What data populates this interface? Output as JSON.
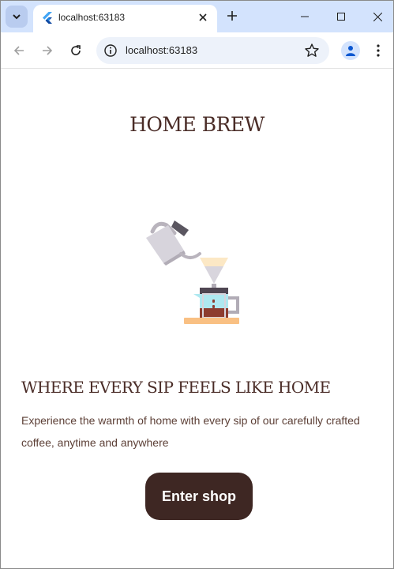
{
  "browser": {
    "tab_title": "localhost:63183",
    "url": "localhost:63183",
    "icons": {
      "tab_search": "chevron-down-icon",
      "favicon": "flutter-icon",
      "tab_close": "close-icon",
      "new_tab": "plus-icon",
      "minimize": "minimize-icon",
      "maximize": "maximize-icon",
      "close_window": "close-icon",
      "back": "arrow-left-icon",
      "forward": "arrow-right-icon",
      "reload": "reload-icon",
      "site_info": "info-icon",
      "bookmark": "star-icon",
      "profile": "person-icon",
      "menu": "more-vert-icon"
    }
  },
  "app": {
    "brand_title": "HOME BREW",
    "headline": "WHERE EVERY SIP FEELS LIKE HOME",
    "description": "Experience the warmth of home with every sip of our carefully crafted coffee, anytime and anywhere",
    "cta_label": "Enter shop",
    "colors": {
      "primary": "#3e2723",
      "heading": "#4a2c27",
      "body_text": "#5d4037"
    }
  }
}
